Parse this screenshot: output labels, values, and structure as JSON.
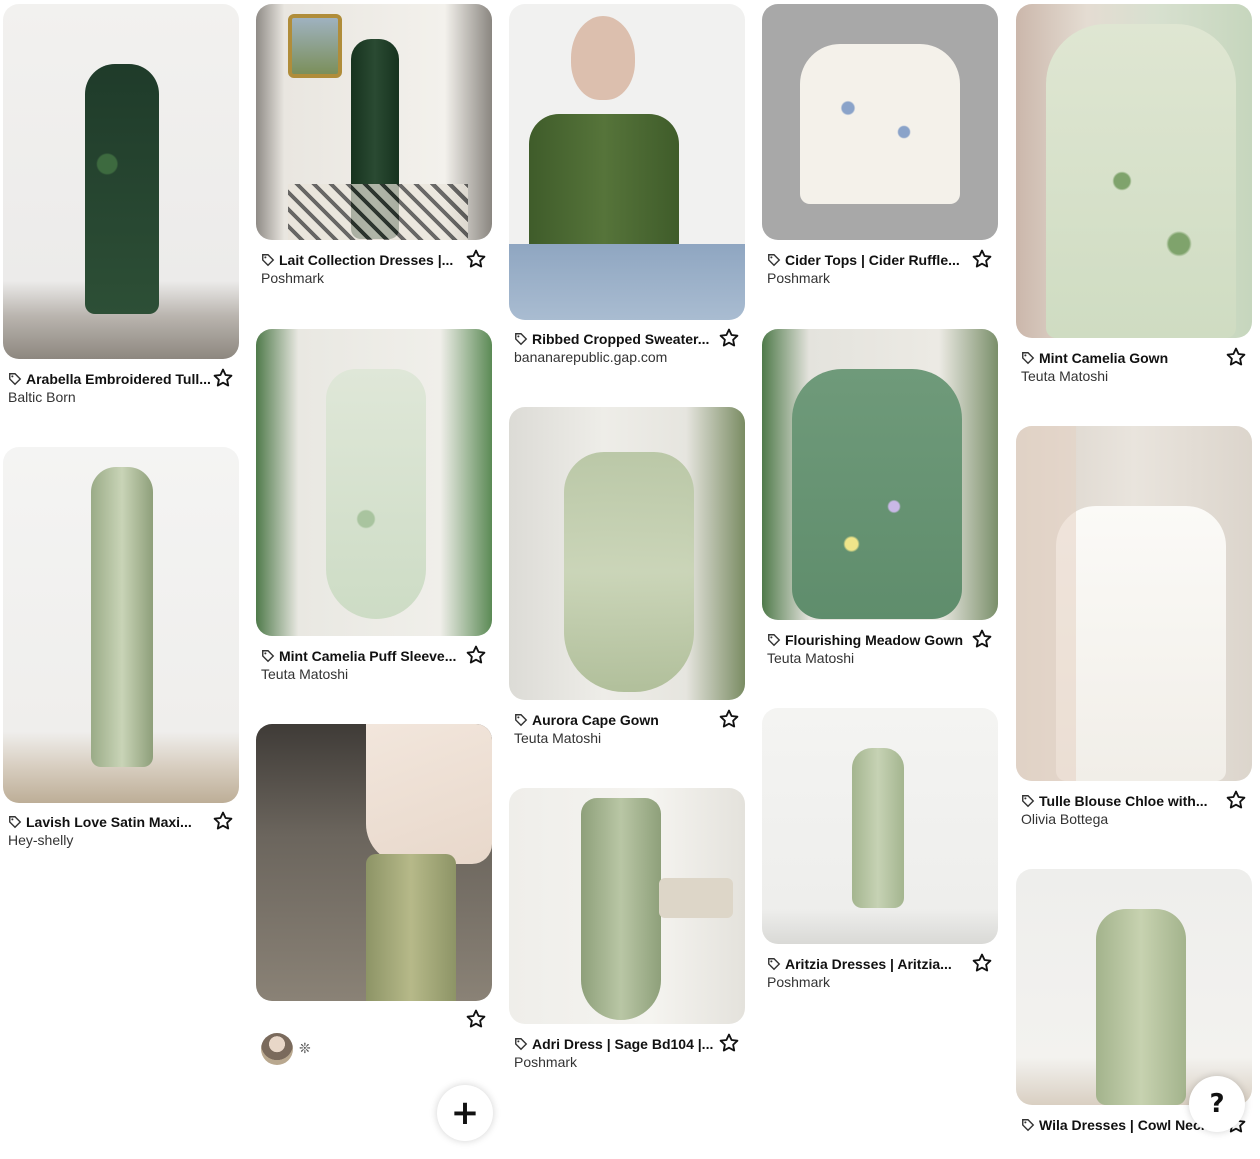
{
  "pins": [
    {
      "title": "Arabella Embroidered Tull...",
      "source": "Baltic Born",
      "image": "dark green embroidered tulle dress"
    },
    {
      "title": "Lait Collection Dresses |...",
      "source": "Poshmark",
      "image": "green velvet dress in vintage room"
    },
    {
      "title": "Ribbed Cropped Sweater...",
      "source": "bananarepublic.gap.com",
      "image": "olive ribbed knit top"
    },
    {
      "title": "Cider Tops | Cider Ruffle...",
      "source": "Poshmark",
      "image": "floral ruffle sleeve top"
    },
    {
      "title": "Mint Camelia Gown",
      "source": "Teuta Matoshi",
      "image": "mint floral embroidered gown"
    },
    {
      "title": "Lavish Love Satin Maxi...",
      "source": "Hey-shelly",
      "image": "sage satin backless maxi dress"
    },
    {
      "title": "Mint Camelia Puff Sleeve...",
      "source": "Teuta Matoshi",
      "image": "mint puff sleeve midi dress"
    },
    {
      "title": "Flourishing Meadow Gown",
      "source": "Teuta Matoshi",
      "image": "green floral tulle gown"
    },
    {
      "title": "Aurora Cape Gown",
      "source": "Teuta Matoshi",
      "image": "sage cape gown"
    },
    {
      "title": "Tulle Blouse Chloe with...",
      "source": "Olivia Bottega",
      "image": "white corset with sheer pearl sleeves"
    },
    {
      "title": "",
      "source": "",
      "image": "sage satin skirt outfit on beach"
    },
    {
      "title": "Adri Dress | Sage Bd104 |...",
      "source": "Poshmark",
      "image": "sage satin cowl gown"
    },
    {
      "title": "Aritzia Dresses | Aritzia...",
      "source": "Poshmark",
      "image": "sage slip midi dress"
    },
    {
      "title": "Wila Dresses | Cowl Neck...",
      "source": "",
      "image": "sage cowl neck slip dress"
    }
  ],
  "controls": {
    "add_label": "+",
    "help_label": "?",
    "sparkle": "❊"
  },
  "icons": {
    "tag": "tag-icon",
    "save": "star-outline-icon",
    "avatar": "user-avatar"
  }
}
